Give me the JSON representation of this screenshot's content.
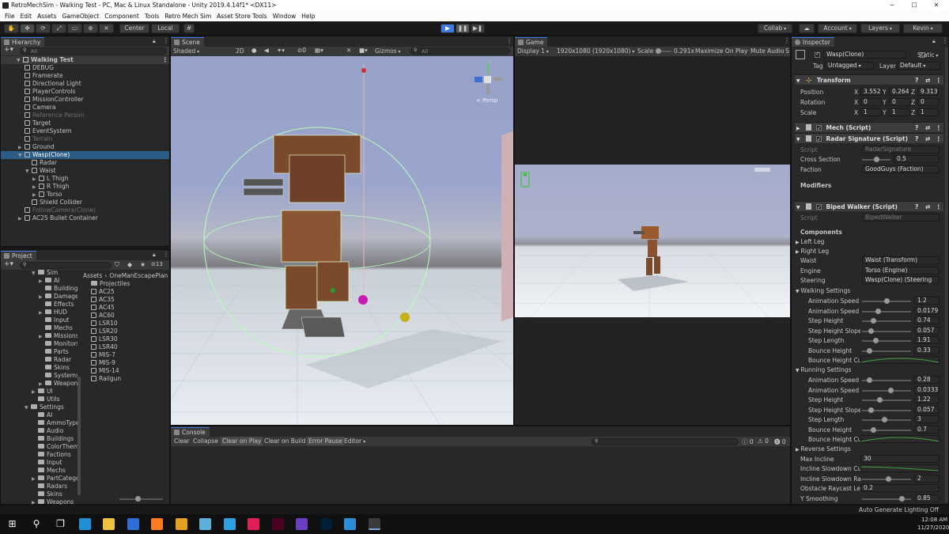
{
  "window": {
    "title": "RetroMechSim - Walking Test - PC, Mac & Linux Standalone - Unity 2019.4.14f1* <DX11>",
    "controls": [
      "─",
      "☐",
      "✕"
    ]
  },
  "menu": [
    "File",
    "Edit",
    "Assets",
    "GameObject",
    "Component",
    "Tools",
    "Retro Mech Sim",
    "Asset Store Tools",
    "Window",
    "Help"
  ],
  "toolbar": {
    "pivot": "Center",
    "space": "Local",
    "collab": "Collab",
    "account": "Account",
    "layers": "Layers",
    "layout": "Kevin"
  },
  "hierarchy": {
    "tab": "Hierarchy",
    "search_placeholder": "All",
    "scene_name": "Walking Test",
    "items": [
      {
        "label": "DEBUG",
        "indent": 1,
        "dim": false
      },
      {
        "label": "Framerate",
        "indent": 1,
        "dim": false
      },
      {
        "label": "Directional Light",
        "indent": 1,
        "dim": false
      },
      {
        "label": "PlayerControls",
        "indent": 1,
        "dim": false
      },
      {
        "label": "MissionController",
        "indent": 1,
        "dim": false
      },
      {
        "label": "Camera",
        "indent": 1,
        "dim": false
      },
      {
        "label": "Reference Person",
        "indent": 1,
        "dim": true
      },
      {
        "label": "Target",
        "indent": 1,
        "dim": false
      },
      {
        "label": "EventSystem",
        "indent": 1,
        "dim": false
      },
      {
        "label": "Terrain",
        "indent": 1,
        "dim": true
      },
      {
        "label": "Ground",
        "indent": 1,
        "dim": false,
        "arrow": "▶"
      },
      {
        "label": "Wasp(Clone)",
        "indent": 1,
        "dim": false,
        "arrow": "▼",
        "selected": true
      },
      {
        "label": "Radar",
        "indent": 2,
        "dim": false
      },
      {
        "label": "Waist",
        "indent": 2,
        "dim": false,
        "arrow": "▼"
      },
      {
        "label": "L Thigh",
        "indent": 3,
        "dim": false,
        "arrow": "▶"
      },
      {
        "label": "R Thigh",
        "indent": 3,
        "dim": false,
        "arrow": "▶"
      },
      {
        "label": "Torso",
        "indent": 3,
        "dim": false,
        "arrow": "▶"
      },
      {
        "label": "Shield Collider",
        "indent": 2,
        "dim": false
      },
      {
        "label": "FollowCamera(Clone)",
        "indent": 1,
        "dim": true
      },
      {
        "label": "AC25 Bullet Container",
        "indent": 1,
        "dim": false,
        "arrow": "▶"
      }
    ]
  },
  "project": {
    "tab": "Project",
    "badge": "13",
    "breadcrumb": [
      "Assets",
      "OneManEscapePlan"
    ],
    "tree": [
      {
        "label": "Sim",
        "indent": 1,
        "arrow": "▼"
      },
      {
        "label": "AI",
        "indent": 2,
        "arrow": "▶"
      },
      {
        "label": "Buildings",
        "indent": 2,
        "arrow": ""
      },
      {
        "label": "Damage",
        "indent": 2,
        "arrow": "▶"
      },
      {
        "label": "Effects",
        "indent": 2,
        "arrow": ""
      },
      {
        "label": "HUD",
        "indent": 2,
        "arrow": "▶"
      },
      {
        "label": "Input",
        "indent": 2,
        "arrow": ""
      },
      {
        "label": "Mechs",
        "indent": 2,
        "arrow": ""
      },
      {
        "label": "Missions",
        "indent": 2,
        "arrow": "▶"
      },
      {
        "label": "Monitors",
        "indent": 2,
        "arrow": ""
      },
      {
        "label": "Parts",
        "indent": 2,
        "arrow": ""
      },
      {
        "label": "Radar",
        "indent": 2,
        "arrow": ""
      },
      {
        "label": "Skins",
        "indent": 2,
        "arrow": ""
      },
      {
        "label": "Systems",
        "indent": 2,
        "arrow": ""
      },
      {
        "label": "Weapons",
        "indent": 2,
        "arrow": "▶"
      },
      {
        "label": "UI",
        "indent": 1,
        "arrow": "▶"
      },
      {
        "label": "Utils",
        "indent": 1,
        "arrow": ""
      },
      {
        "label": "Settings",
        "indent": 0,
        "arrow": "▼"
      },
      {
        "label": "AI",
        "indent": 1,
        "arrow": ""
      },
      {
        "label": "AmmoTypes",
        "indent": 1,
        "arrow": ""
      },
      {
        "label": "Audio",
        "indent": 1,
        "arrow": ""
      },
      {
        "label": "Buildings",
        "indent": 1,
        "arrow": ""
      },
      {
        "label": "ColorThemes",
        "indent": 1,
        "arrow": ""
      },
      {
        "label": "Factions",
        "indent": 1,
        "arrow": ""
      },
      {
        "label": "Input",
        "indent": 1,
        "arrow": ""
      },
      {
        "label": "Mechs",
        "indent": 1,
        "arrow": ""
      },
      {
        "label": "PartCategories",
        "indent": 1,
        "arrow": "▶"
      },
      {
        "label": "Radars",
        "indent": 1,
        "arrow": ""
      },
      {
        "label": "Skins",
        "indent": 1,
        "arrow": ""
      },
      {
        "label": "Weapons",
        "indent": 1,
        "arrow": "▶"
      }
    ],
    "assets": [
      "Projectiles",
      "AC25",
      "AC35",
      "AC45",
      "AC60",
      "LSR10",
      "LSR20",
      "LSR30",
      "LSR40",
      "MIS-7",
      "MIS-9",
      "MIS-14",
      "Railgun"
    ]
  },
  "scene_view": {
    "tab": "Scene",
    "shading": "Shaded",
    "mode_2d": "2D",
    "gizmos": "Gizmos",
    "search_placeholder": "All",
    "persp": "< Persp",
    "axis_y": "y",
    "axis_z": "z",
    "hidden_count": "0"
  },
  "game_view": {
    "tab": "Game",
    "display": "Display 1",
    "resolution": "1920x1080 (1920x1080)",
    "scale_label": "Scale",
    "scale_value": "0.291x",
    "maximize": "Maximize On Play",
    "mute": "Mute Audio",
    "stats": "S"
  },
  "console": {
    "tab": "Console",
    "buttons": [
      "Clear",
      "Collapse",
      "Clear on Play",
      "Clear on Build",
      "Error Pause",
      "Editor"
    ],
    "counts": [
      "0",
      "0",
      "0"
    ]
  },
  "inspector": {
    "tab": "Inspector",
    "object_name": "Wasp(Clone)",
    "static_label": "Static",
    "tag_label": "Tag",
    "tag_value": "Untagged",
    "layer_label": "Layer",
    "layer_value": "Default",
    "transform": {
      "title": "Transform",
      "rows": [
        {
          "label": "Position",
          "x": "3.5524",
          "y": "0.2643",
          "z": "9.3130"
        },
        {
          "label": "Rotation",
          "x": "0",
          "y": "0",
          "z": "0"
        },
        {
          "label": "Scale",
          "x": "1",
          "y": "1",
          "z": "1"
        }
      ]
    },
    "mech_title": "Mech (Script)",
    "radar": {
      "title": "Radar Signature (Script)",
      "script_label": "Script",
      "script_value": "RadarSignature",
      "cross_label": "Cross Section",
      "cross_value": "0.5",
      "cross_fraction": 0.5,
      "faction_label": "Faction",
      "faction_value": "GoodGuys (Faction)",
      "modifiers": "Modifiers"
    },
    "biped": {
      "title": "Biped Walker (Script)",
      "script_label": "Script",
      "script_value": "BipedWalker",
      "components": "Components",
      "left_leg": "Left Leg",
      "right_leg": "Right Leg",
      "waist_label": "Waist",
      "waist_value": "Waist (Transform)",
      "engine_label": "Engine",
      "engine_value": "Torso (Engine)",
      "steering_label": "Steering",
      "steering_value": "Wasp(Clone) (Steering"
    },
    "walking": {
      "title": "Walking Settings",
      "rows": [
        {
          "label": "Animation Speed",
          "value": "1.2",
          "fraction": 0.5
        },
        {
          "label": "Animation Speed S",
          "value": "0.0179",
          "fraction": 0.3
        },
        {
          "label": "Step Height",
          "value": "0.74",
          "fraction": 0.2
        },
        {
          "label": "Step Height Slope",
          "value": "0.057",
          "fraction": 0.15
        },
        {
          "label": "Step Length",
          "value": "1.91",
          "fraction": 0.25
        },
        {
          "label": "Bounce Height",
          "value": "0.33",
          "fraction": 0.1
        },
        {
          "label": "Bounce Height Cu",
          "value": "",
          "fraction": null
        }
      ]
    },
    "running": {
      "title": "Running Settings",
      "rows": [
        {
          "label": "Animation Speed",
          "value": "0.28",
          "fraction": 0.1
        },
        {
          "label": "Animation Speed S",
          "value": "0.0333",
          "fraction": 0.6
        },
        {
          "label": "Step Height",
          "value": "1.22",
          "fraction": 0.35
        },
        {
          "label": "Step Height Slope",
          "value": "0.057",
          "fraction": 0.15
        },
        {
          "label": "Step Length",
          "value": "3",
          "fraction": 0.45
        },
        {
          "label": "Bounce Height",
          "value": "0.7",
          "fraction": 0.2
        },
        {
          "label": "Bounce Height Cu",
          "value": "",
          "fraction": null
        }
      ]
    },
    "reverse": {
      "title": "Reverse Settings",
      "max_incline_label": "Max Incline",
      "max_incline_value": "30",
      "incline_curve_label": "Incline Slowdown Cu",
      "incline_rate_label": "Incline Slowdown Ra",
      "incline_rate_value": "2",
      "incline_rate_fraction": 0.55,
      "raycast_label": "Obstacle Raycast Len",
      "raycast_value": "0.2",
      "smoothing_label": "Y Smoothing",
      "smoothing_value": "0.85",
      "smoothing_fraction": 0.85
    }
  },
  "status": {
    "lighting": "Auto Generate Lighting Off"
  },
  "taskbar": {
    "time": "12:08 AM",
    "date": "11/27/2020",
    "icons": [
      "windows-icon",
      "search-icon",
      "task-view-icon",
      "edge-icon",
      "file-explorer-icon",
      "maps-icon",
      "firefox-icon",
      "blender-icon",
      "notepad-icon",
      "phone-icon",
      "slack-icon",
      "indesign-icon",
      "visual-studio-icon",
      "photoshop-icon",
      "photos-icon",
      "unity-icon"
    ]
  },
  "colors": {
    "accent": "#3e7be0",
    "selection": "#2c5d87",
    "panel": "#282828",
    "header": "#3c3c3c",
    "curve": "#3fa03f"
  }
}
